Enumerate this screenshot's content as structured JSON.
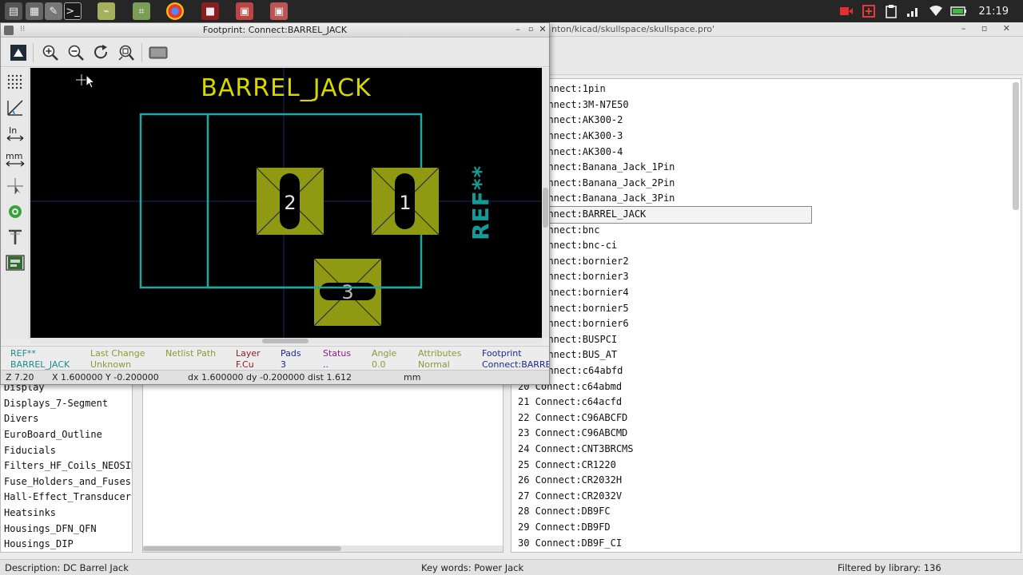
{
  "taskbar": {
    "clock": "21:19",
    "apps": [
      "files-icon",
      "window-icon",
      "text-editor-icon",
      "terminal-icon",
      "kicad-icon",
      "pcb-icon",
      "chrome-icon",
      "app-red-icon",
      "app-window-icon",
      "app-window-icon-2"
    ],
    "tray": [
      "record-icon",
      "plus-icon",
      "clipboard-icon",
      "signal-icon",
      "wifi-icon",
      "battery-icon"
    ]
  },
  "bg_window": {
    "title": "nton/kicad/skullspace/skullspace.pro'"
  },
  "libraries": [
    "Display",
    "Displays_7-Segment",
    "Divers",
    "EuroBoard_Outline",
    "Fiducials",
    "Filters_HF_Coils_NEOSID",
    "Fuse_Holders_and_Fuses",
    "Hall-Effect_Transducers",
    "Heatsinks",
    "Housings_DFN_QFN",
    "Housings_DIP"
  ],
  "footprints": [
    "Connect:1pin",
    "Connect:3M-N7E50",
    "Connect:AK300-2",
    "Connect:AK300-3",
    "Connect:AK300-4",
    "Connect:Banana_Jack_1Pin",
    "Connect:Banana_Jack_2Pin",
    "Connect:Banana_Jack_3Pin",
    "Connect:BARREL_JACK",
    "Connect:bnc",
    "Connect:bnc-ci",
    "Connect:bornier2",
    "Connect:bornier3",
    "Connect:bornier4",
    "Connect:bornier5",
    "Connect:bornier6",
    "Connect:BUSPCI",
    "Connect:BUS_AT",
    "Connect:c64abfd",
    "20 Connect:c64abmd",
    "21 Connect:c64acfd",
    "22 Connect:C96ABCFD",
    "23 Connect:C96ABCMD",
    "24 Connect:CNT3BRCMS",
    "25 Connect:CR1220",
    "26 Connect:CR2032H",
    "27 Connect:CR2032V",
    "28 Connect:DB9FC",
    "29 Connect:DB9FD",
    "30 Connect:DB9F_CI"
  ],
  "selected_footprint_index": 8,
  "statusbar": {
    "description": "Description: DC Barrel Jack",
    "keywords": "Key words: Power Jack",
    "filtered": "Filtered by library: 136"
  },
  "fp_window": {
    "title": "Footprint: Connect:BARREL_JACK",
    "canvas": {
      "value_text": "BARREL_JACK",
      "ref_text": "REF**",
      "pads": [
        "1",
        "2",
        "3"
      ]
    },
    "message_panel": {
      "ref": {
        "label": "REF**",
        "value": "BARREL_JACK"
      },
      "last_change": {
        "label": "Last Change",
        "value": "Unknown"
      },
      "netlist_path": {
        "label": "Netlist Path",
        "value": ""
      },
      "layer": {
        "label": "Layer",
        "value": "F.Cu"
      },
      "pads": {
        "label": "Pads",
        "value": "3"
      },
      "status": {
        "label": "Status",
        "value": ".."
      },
      "angle": {
        "label": "Angle",
        "value": "0.0"
      },
      "attributes": {
        "label": "Attributes",
        "value": "Normal"
      },
      "footprint": {
        "label": "Footprint",
        "value": "Connect:BARREL_JACK"
      }
    },
    "status": {
      "zoom": "Z 7.20",
      "xy": "X 1.600000  Y -0.200000",
      "delta": "dx 1.600000  dy -0.200000  dist 1.612",
      "units": "mm"
    },
    "colors": {
      "canvas_bg": "#000000",
      "outline": "#1fa7a1",
      "pad": "#8f9a12",
      "text_yellow": "#d7d700",
      "ref_teal": "#149a97"
    }
  }
}
